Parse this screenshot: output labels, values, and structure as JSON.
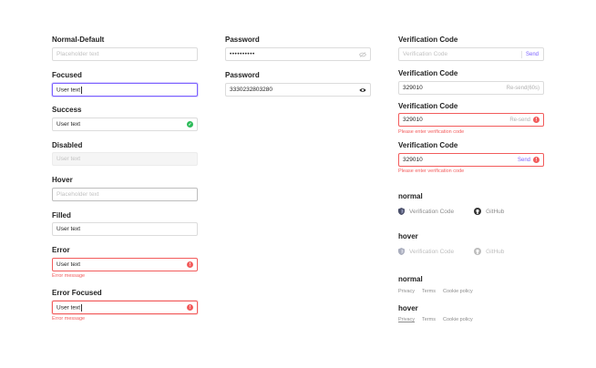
{
  "col1": {
    "normal": {
      "label": "Normal-Default",
      "placeholder": "Placeholder text"
    },
    "focused": {
      "label": "Focused",
      "value": "User text"
    },
    "success": {
      "label": "Success",
      "value": "User text"
    },
    "disabled": {
      "label": "Disabled",
      "placeholder": "User text"
    },
    "hover": {
      "label": "Hover",
      "placeholder": "Placeholder text"
    },
    "filled": {
      "label": "Filled",
      "value": "User text"
    },
    "error": {
      "label": "Error",
      "value": "User text",
      "message": "Error message"
    },
    "error_focused": {
      "label": "Error Focused",
      "value": "User text",
      "message": "Error message"
    }
  },
  "col2": {
    "password_hidden": {
      "label": "Password",
      "value": "••••••••••"
    },
    "password_shown": {
      "label": "Password",
      "value": "3330232803280"
    }
  },
  "col3": {
    "vc1": {
      "label": "Verification Code",
      "placeholder": "Verification Code",
      "action": "Send"
    },
    "vc2": {
      "label": "Verification Code",
      "value": "329010",
      "action": "Re-send(60s)"
    },
    "vc3": {
      "label": "Verification Code",
      "value": "329010",
      "action": "Re-send",
      "message": "Please enter verification code"
    },
    "vc4": {
      "label": "Verification Code",
      "value": "329010",
      "action": "Send",
      "message": "Please enter verification code"
    },
    "social_normal": {
      "label": "normal",
      "verification": "Verification Code",
      "github": "GitHub"
    },
    "social_hover": {
      "label": "hover",
      "verification": "Verification Code",
      "github": "GitHub"
    },
    "links_normal": {
      "label": "normal",
      "privacy": "Privacy",
      "terms": "Terms",
      "cookie": "Cookie policy"
    },
    "links_hover": {
      "label": "hover",
      "privacy": "Privacy",
      "terms": "Terms",
      "cookie": "Cookie policy"
    }
  },
  "colors": {
    "accent": "#7b61ff",
    "error": "#f25c5c",
    "success": "#2dbb5a",
    "border": "#dcdcdc"
  }
}
